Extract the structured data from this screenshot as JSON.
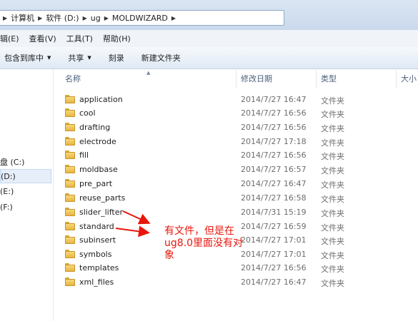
{
  "address": {
    "crumbs": [
      "计算机",
      "软件 (D:)",
      "ug",
      "MOLDWIZARD"
    ]
  },
  "menu": {
    "items": [
      "辑(E)",
      "查看(V)",
      "工具(T)",
      "帮助(H)"
    ]
  },
  "toolbar": {
    "include_library": "包含到库中",
    "share": "共享",
    "burn": "刻录",
    "new_folder": "新建文件夹"
  },
  "nav": {
    "drives": [
      {
        "label": "盘 (C:)",
        "selected": false
      },
      {
        "label": "(D:)",
        "selected": true
      },
      {
        "label": "(E:)",
        "selected": false
      },
      {
        "label": "(F:)",
        "selected": false
      }
    ]
  },
  "columns": {
    "name": "名称",
    "modified": "修改日期",
    "type": "类型",
    "size": "大小"
  },
  "files": [
    {
      "name": "application",
      "date": "2014/7/27 16:47",
      "type": "文件夹"
    },
    {
      "name": "cool",
      "date": "2014/7/27 16:56",
      "type": "文件夹"
    },
    {
      "name": "drafting",
      "date": "2014/7/27 16:56",
      "type": "文件夹"
    },
    {
      "name": "electrode",
      "date": "2014/7/27 17:18",
      "type": "文件夹"
    },
    {
      "name": "fill",
      "date": "2014/7/27 16:56",
      "type": "文件夹"
    },
    {
      "name": "moldbase",
      "date": "2014/7/27 16:57",
      "type": "文件夹"
    },
    {
      "name": "pre_part",
      "date": "2014/7/27 16:47",
      "type": "文件夹"
    },
    {
      "name": "reuse_parts",
      "date": "2014/7/27 16:58",
      "type": "文件夹"
    },
    {
      "name": "slider_lifter",
      "date": "2014/7/31 15:19",
      "type": "文件夹"
    },
    {
      "name": "standard",
      "date": "2014/7/27 16:59",
      "type": "文件夹"
    },
    {
      "name": "subinsert",
      "date": "2014/7/27 17:01",
      "type": "文件夹"
    },
    {
      "name": "symbols",
      "date": "2014/7/27 17:01",
      "type": "文件夹"
    },
    {
      "name": "templates",
      "date": "2014/7/27 16:56",
      "type": "文件夹"
    },
    {
      "name": "xml_files",
      "date": "2014/7/27 16:47",
      "type": "文件夹"
    }
  ],
  "annotation": {
    "text": "有文件，但是在ug8.0里面没有对象",
    "color": "#e8160c"
  }
}
